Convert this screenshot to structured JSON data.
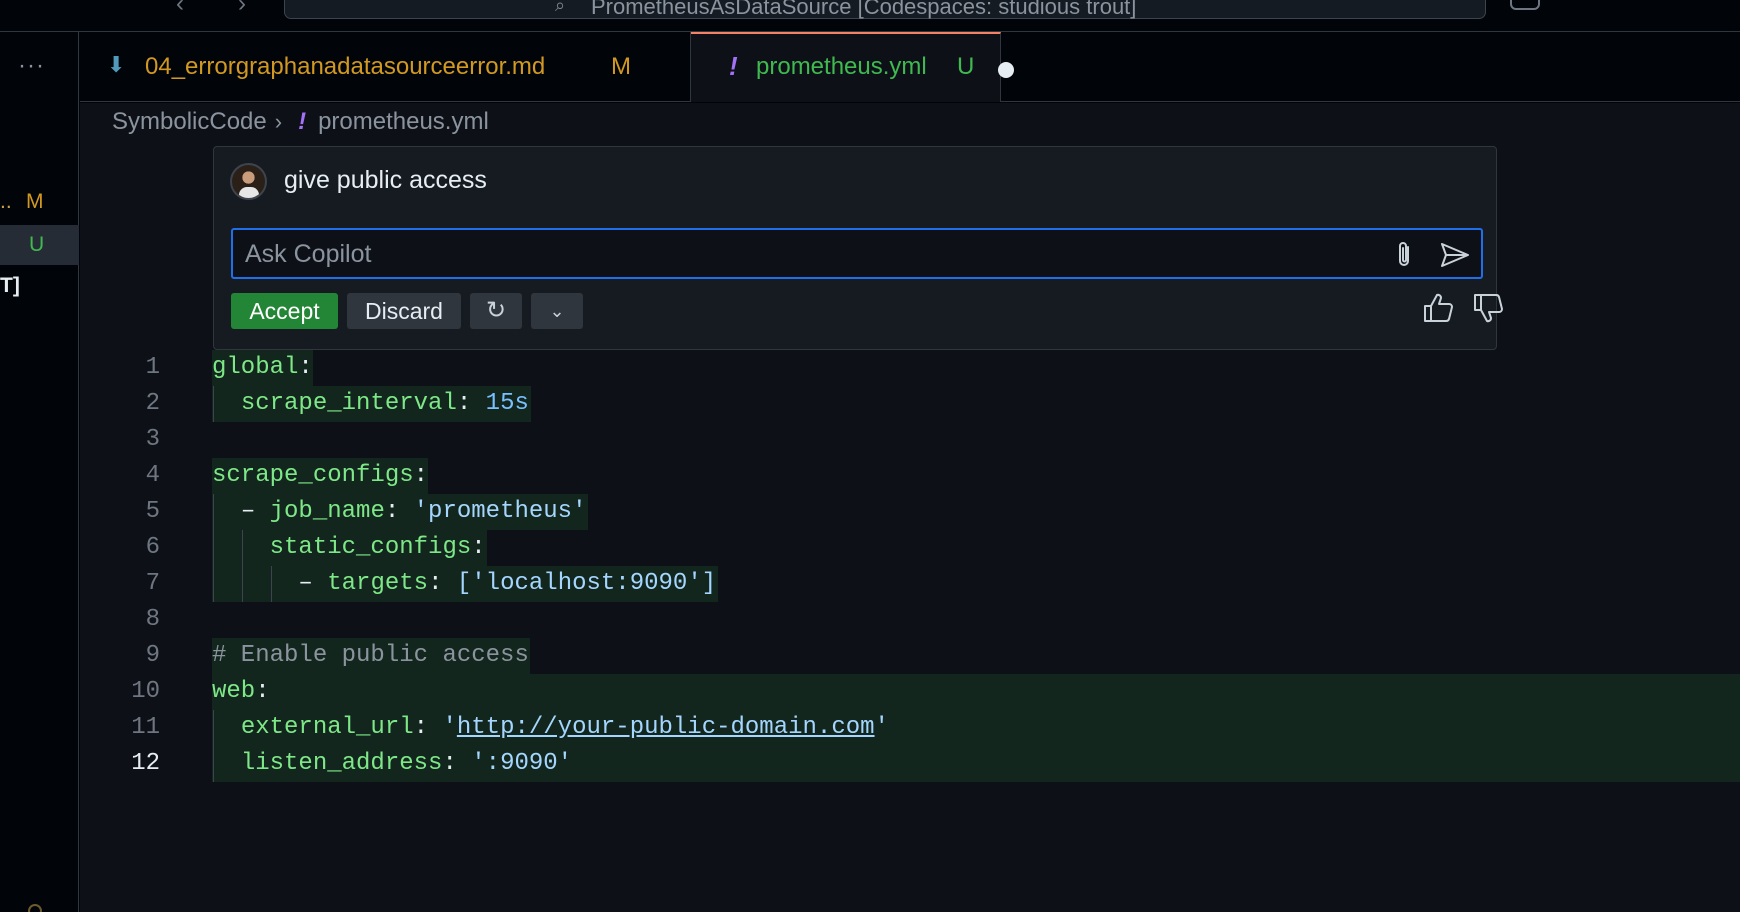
{
  "titlebar": {
    "back_arrow": "‹",
    "forward_arrow": "›",
    "command_center_text": "PrometheusAsDataSource [Codespaces: studious trout]"
  },
  "left_panel": {
    "menu_dots": "···",
    "rows": [
      {
        "ellipsis": "..",
        "status": "M"
      },
      {
        "ellipsis": "",
        "status": "U"
      },
      {
        "ellipsis": "",
        "status": "T]"
      }
    ]
  },
  "tabs": [
    {
      "icon": "⬇",
      "label": "04_errorgraphanadatasourceerror.md",
      "status": "M",
      "active": false
    },
    {
      "icon": "!",
      "label": "prometheus.yml",
      "status": "U",
      "active": true,
      "dirty": true
    }
  ],
  "breadcrumb": {
    "root": "SymbolicCode",
    "separator": "›",
    "file_icon": "!",
    "file": "prometheus.yml"
  },
  "inline_chat": {
    "prompt": "give public access",
    "input_placeholder": "Ask Copilot",
    "input_value": "",
    "accept_label": "Accept",
    "discard_label": "Discard",
    "rerun_glyph": "↻",
    "more_glyph": "⌄"
  },
  "code": {
    "active_line": 12,
    "lines": [
      {
        "num": "1"
      },
      {
        "num": "2"
      },
      {
        "num": "3"
      },
      {
        "num": "4"
      },
      {
        "num": "5"
      },
      {
        "num": "6"
      },
      {
        "num": "7"
      },
      {
        "num": "8"
      },
      {
        "num": "9"
      },
      {
        "num": "10"
      },
      {
        "num": "11"
      },
      {
        "num": "12"
      }
    ],
    "tokens": {
      "l1_key": "global",
      "colon": ":",
      "l2_key": "scrape_interval",
      "l2_val": "15s",
      "l4_key": "scrape_configs",
      "dash": "–",
      "l5_key": "job_name",
      "l5_val": "'prometheus'",
      "l6_key": "static_configs",
      "l7_key": "targets",
      "l7_val": "['localhost:9090']",
      "l9_comment": "# Enable public access",
      "l10_key": "web",
      "l11_key": "external_url",
      "quote": "'",
      "l11_url": "http://your-public-domain.com",
      "l12_key": "listen_address",
      "l12_val": "':9090'"
    }
  }
}
